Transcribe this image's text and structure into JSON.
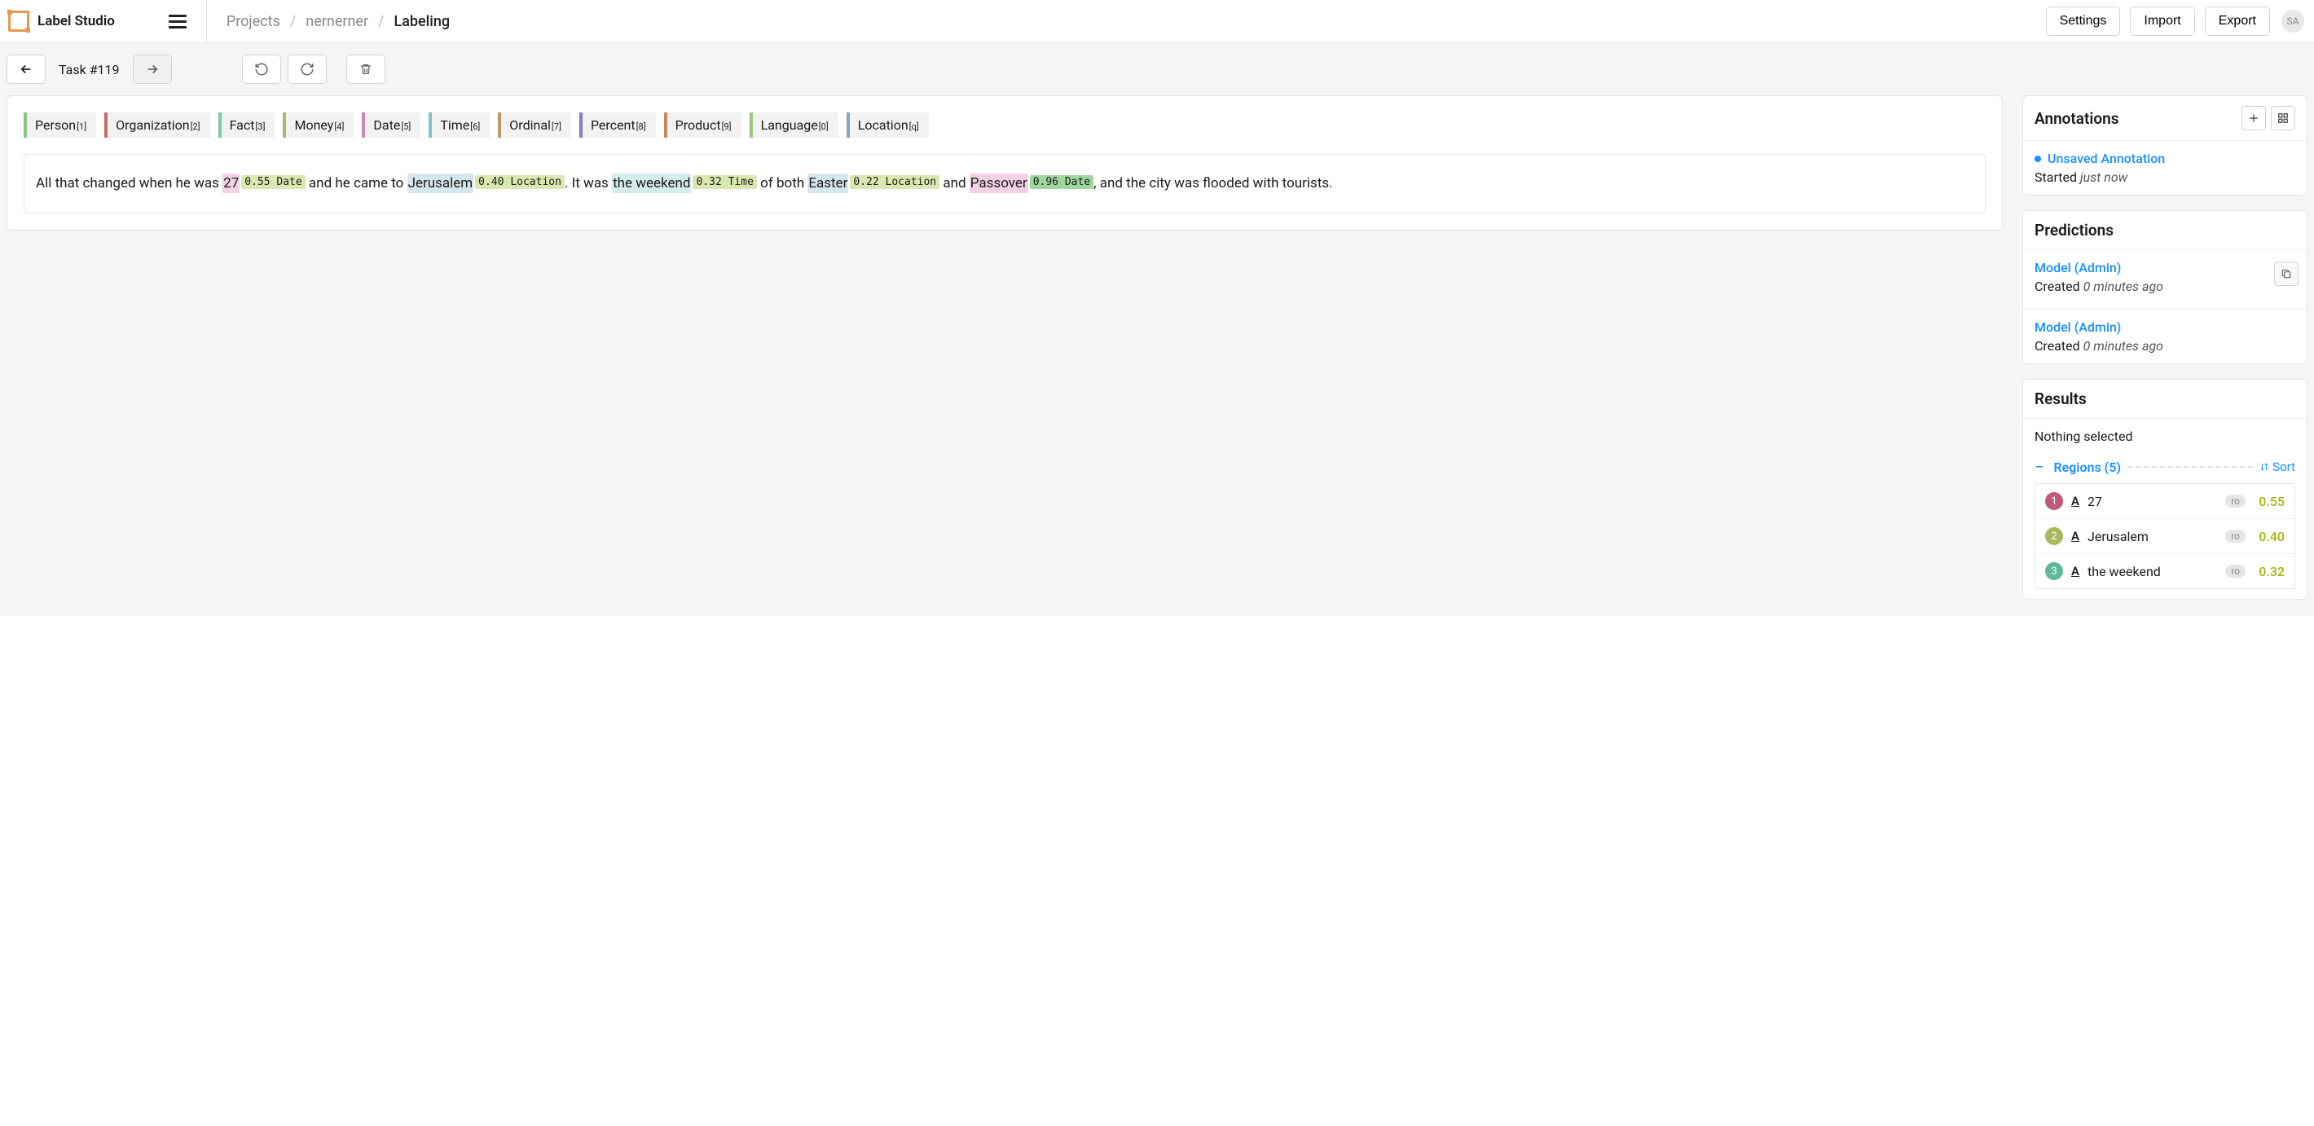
{
  "brand": "Label Studio",
  "breadcrumbs": {
    "root": "Projects",
    "project": "nernerner",
    "page": "Labeling"
  },
  "header_buttons": {
    "settings": "Settings",
    "import": "Import",
    "export": "Export"
  },
  "avatar": "SA",
  "task_label": "Task #119",
  "labels": [
    {
      "name": "Person",
      "key": "1",
      "color": "#88c28a"
    },
    {
      "name": "Organization",
      "key": "2",
      "color": "#c96a6a"
    },
    {
      "name": "Fact",
      "key": "3",
      "color": "#7fc9a3"
    },
    {
      "name": "Money",
      "key": "4",
      "color": "#a8b86b"
    },
    {
      "name": "Date",
      "key": "5",
      "color": "#c98ab0"
    },
    {
      "name": "Time",
      "key": "6",
      "color": "#7fc4c4"
    },
    {
      "name": "Ordinal",
      "key": "7",
      "color": "#b89a6a"
    },
    {
      "name": "Percent",
      "key": "8",
      "color": "#8a7fc4"
    },
    {
      "name": "Product",
      "key": "9",
      "color": "#c48a5a"
    },
    {
      "name": "Language",
      "key": "0",
      "color": "#a3c47f"
    },
    {
      "name": "Location",
      "key": "q",
      "color": "#7fa8c4"
    }
  ],
  "text": {
    "t0": "All that changed when he was ",
    "s1": "27",
    "b1_score": "0.55",
    "b1_label": "Date",
    "t1": " and he came to ",
    "s2": "Jerusalem",
    "b2_score": "0.40",
    "b2_label": "Location",
    "t2": ". It was ",
    "s3": "the weekend",
    "b3_score": "0.32",
    "b3_label": "Time",
    "t3": " of both ",
    "s4": "Easter",
    "b4_score": "0.22",
    "b4_label": "Location",
    "t4": " and ",
    "s5": "Passover",
    "b5_score": "0.96",
    "b5_label": "Date",
    "t5": ", and the city was flooded with tourists."
  },
  "colors": {
    "date_bg": "#f2d1e4",
    "date_badge": "#d9e8b0",
    "loc_bg": "#d6e6ef",
    "loc_badge": "#d9e8b0",
    "time_bg": "#d4ecec",
    "time_badge": "#d9e8b0",
    "pass_badge": "#9fd89f"
  },
  "annotations": {
    "title": "Annotations",
    "unsaved": "Unsaved Annotation",
    "started_label": "Started ",
    "started_time": "just now"
  },
  "predictions": {
    "title": "Predictions",
    "items": [
      {
        "model": "Model (Admin)",
        "created_label": "Created ",
        "created_time": "0 minutes ago",
        "copy": true
      },
      {
        "model": "Model (Admin)",
        "created_label": "Created ",
        "created_time": "0 minutes ago",
        "copy": false
      }
    ]
  },
  "results": {
    "title": "Results",
    "nothing": "Nothing selected",
    "regions_label": "Regions (5)",
    "sort": "Sort",
    "ro": "ro",
    "items": [
      {
        "n": "1",
        "text": "27",
        "score": "0.55",
        "color": "#c15a7a"
      },
      {
        "n": "2",
        "text": "Jerusalem",
        "score": "0.40",
        "color": "#aab85d"
      },
      {
        "n": "3",
        "text": "the weekend",
        "score": "0.32",
        "color": "#5fb89a"
      }
    ]
  }
}
